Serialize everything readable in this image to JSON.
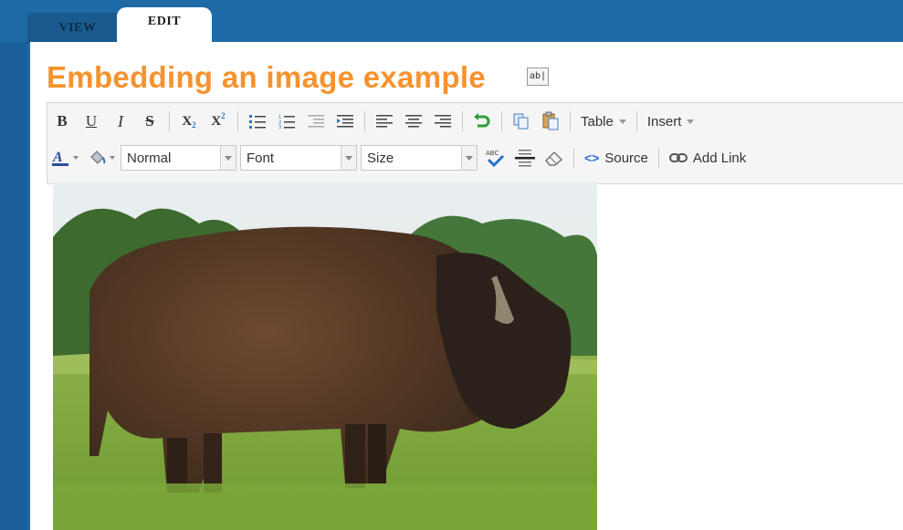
{
  "tabs": {
    "view_label": "VIEW",
    "edit_label": "EDIT"
  },
  "page": {
    "title": "Embedding an image example",
    "title_edit_icon_text": "ab|"
  },
  "toolbar": {
    "bold": "B",
    "underline": "U",
    "italic": "I",
    "strike": "S",
    "subscript": "X",
    "superscript": "X",
    "table_label": "Table",
    "insert_label": "Insert",
    "format_value": "Normal",
    "font_value": "Font",
    "size_value": "Size",
    "source_label": "Source",
    "add_link_label": "Add Link",
    "spellcheck_text": "ABC"
  },
  "colors": {
    "accent": "#f7922e",
    "frame": "#1e6aa6",
    "tab_inactive_text": "#0d2c45"
  },
  "image": {
    "subject": "bison in grassy field"
  }
}
